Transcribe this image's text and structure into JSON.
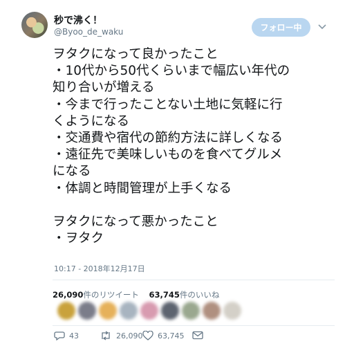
{
  "user": {
    "display_name": "秒で沸く！",
    "handle": "@Byoo_de_waku"
  },
  "header": {
    "follow_label": "フォロー中",
    "menu_icon": "chevron-down-icon"
  },
  "tweet": {
    "lines": [
      "ヲタクになって良かったこと",
      "・10代から50代くらいまで幅広い年代の",
      "知り合いが増える",
      "・今まで行ったことない土地に気軽に行",
      "くようになる",
      "・交通費や宿代の節約方法に詳しくなる",
      "・遠征先で美味しいものを食べてグルメ",
      "になる",
      "・体調と時間管理が上手くなる",
      "",
      "ヲタクになって悪かったこと",
      "・ヲタク"
    ],
    "timestamp": "10:17 - 2018年12月17日"
  },
  "stats": {
    "retweets_count": "26,090",
    "retweets_label": "件のリツイート",
    "likes_count": "63,745",
    "likes_label": "件のいいね"
  },
  "actions": {
    "reply_count": "43",
    "retweet_count": "26,090",
    "like_count": "63,745"
  },
  "colors": {
    "follow_button": "#b9d6f0",
    "muted_text": "#657786",
    "divider": "#e6ecf0"
  }
}
